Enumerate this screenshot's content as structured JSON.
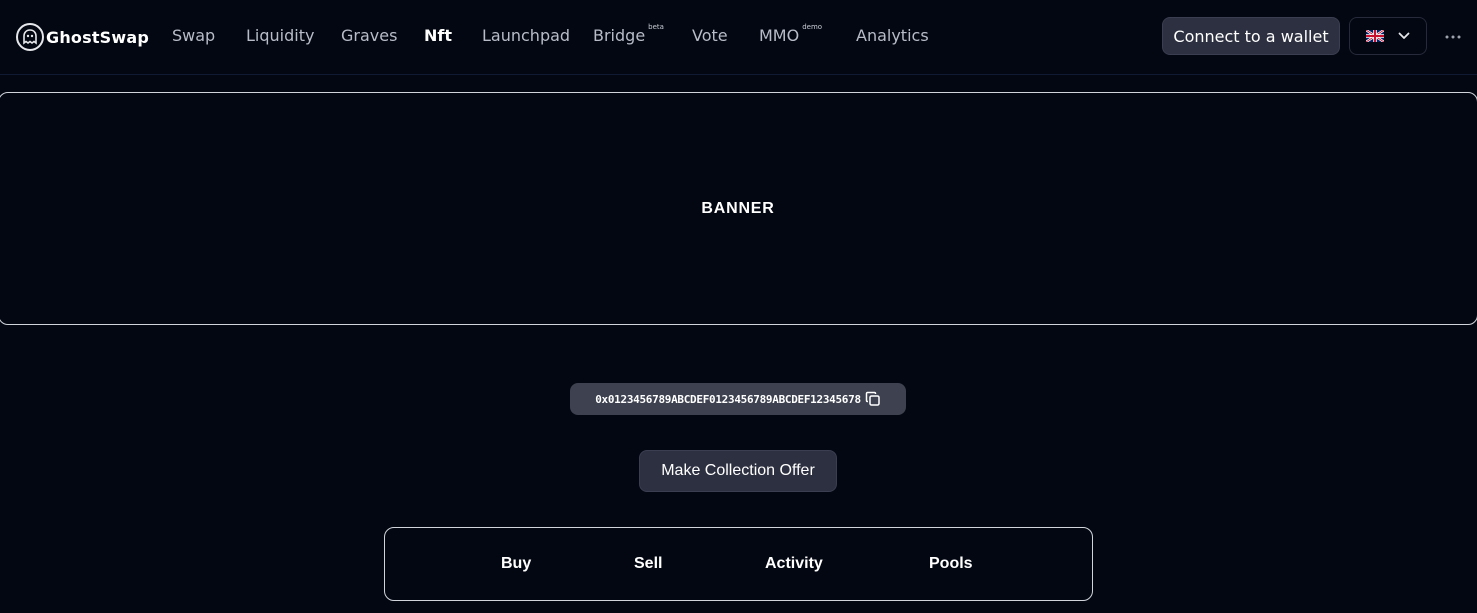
{
  "brand": {
    "name": "GhostSwap"
  },
  "nav": {
    "items": [
      {
        "label": "Swap"
      },
      {
        "label": "Liquidity"
      },
      {
        "label": "Graves"
      },
      {
        "label": "Nft"
      },
      {
        "label": "Launchpad"
      },
      {
        "label": "Bridge",
        "badge": "beta"
      },
      {
        "label": "Vote"
      },
      {
        "label": "MMO",
        "badge": "demo"
      },
      {
        "label": "Analytics"
      }
    ]
  },
  "header": {
    "connect_label": "Connect to a wallet",
    "language_icon": "uk-flag-icon"
  },
  "banner": {
    "label": "BANNER"
  },
  "collection": {
    "address": "0x0123456789ABCDEF0123456789ABCDEF12345678",
    "offer_label": "Make Collection Offer"
  },
  "tabs": [
    {
      "label": "Buy"
    },
    {
      "label": "Sell"
    },
    {
      "label": "Activity"
    },
    {
      "label": "Pools"
    }
  ],
  "colors": {
    "background": "#030712",
    "button": "#2d3040",
    "pill": "#3d4150",
    "border": "#d1d5db"
  }
}
